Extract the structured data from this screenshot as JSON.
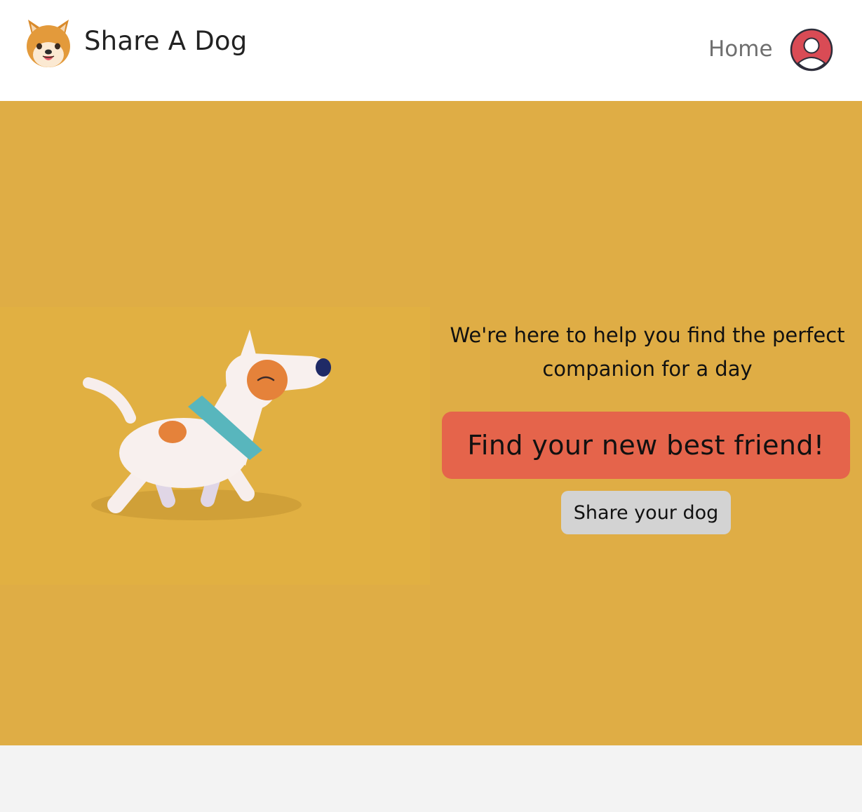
{
  "navbar": {
    "brand_name": "Share A Dog",
    "logo_icon": "shiba-inu-face-icon",
    "links": [
      {
        "label": "Home"
      }
    ],
    "avatar_icon": "user-avatar-icon"
  },
  "hero": {
    "image": "walking-cartoon-dog-illustration",
    "tagline_line1": "We're here to help you find the perfect",
    "tagline_line2": "companion for a day",
    "primary_button": "Find your new best friend!",
    "secondary_button": "Share your dog"
  },
  "colors": {
    "hero_background": "#dfad45",
    "primary_button": "#e5644b",
    "secondary_button": "#d3d3d3",
    "avatar_ring": "#d94b55"
  }
}
